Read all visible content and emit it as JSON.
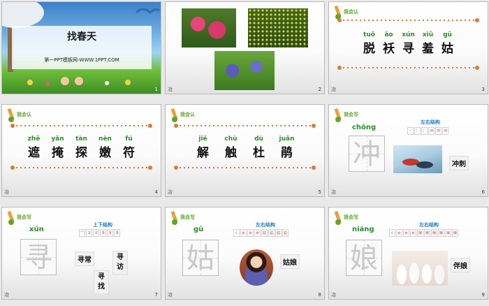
{
  "slides": [
    {
      "number": "1",
      "title": "找春天",
      "subtitle": "第一PPT模板网-WWW.1PPT.COM"
    },
    {
      "number": "2",
      "note": "冶"
    },
    {
      "number": "3",
      "note": "冶",
      "badge": "我会认",
      "pinyin": [
        "tuō",
        "ǎo",
        "xún",
        "xiū",
        "gū"
      ],
      "chars": [
        "脱",
        "袄",
        "寻",
        "羞",
        "姑"
      ]
    },
    {
      "number": "4",
      "note": "冶",
      "badge": "我会认",
      "pinyin": [
        "zhē",
        "yǎn",
        "tàn",
        "nèn",
        "fú"
      ],
      "chars": [
        "遮",
        "掩",
        "探",
        "嫩",
        "符"
      ]
    },
    {
      "number": "5",
      "note": "冶",
      "badge": "我会认",
      "pinyin": [
        "jiě",
        "chù",
        "dù",
        "juān"
      ],
      "chars": [
        "解",
        "触",
        "杜",
        "鹃"
      ]
    },
    {
      "number": "6",
      "note": "冶",
      "badge": "我会写",
      "pinyin": "chōng",
      "char": "冲",
      "structure": "左右结构",
      "strokes": [
        "丶",
        "冫",
        "冫",
        "冲",
        "冲",
        "冲"
      ],
      "word": "冲刺"
    },
    {
      "number": "7",
      "note": "冶",
      "badge": "我会写",
      "pinyin": "xún",
      "char": "寻",
      "structure": "上下结构",
      "strokes": [
        "乛",
        "ヨ",
        "ヨ",
        "寻",
        "寻",
        "寻"
      ],
      "words": [
        "寻常",
        "寻访",
        "寻找"
      ]
    },
    {
      "number": "8",
      "note": "冶",
      "badge": "我会写",
      "pinyin": "gū",
      "char": "姑",
      "structure": "左右结构",
      "strokes": [
        "く",
        "女",
        "女",
        "女",
        "姑",
        "姑",
        "姑",
        "姑"
      ],
      "word": "姑娘"
    },
    {
      "number": "9",
      "note": "冶",
      "badge": "我会写",
      "pinyin": "niáng",
      "char": "娘",
      "structure": "左右结构",
      "strokes": [
        "く",
        "女",
        "女",
        "女",
        "娘",
        "娘",
        "娘",
        "娘",
        "娘",
        "娘"
      ],
      "word": "伴娘"
    }
  ],
  "colors": {
    "pinyin": "#2e8b2e",
    "badge": "#5fa72b",
    "structure": "#1e7ac8",
    "dots": "#d77c3a"
  }
}
